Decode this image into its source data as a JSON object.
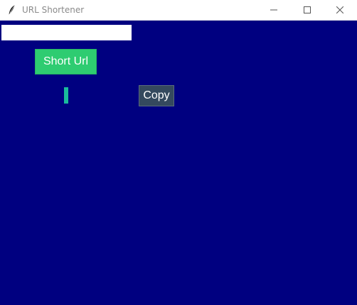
{
  "window": {
    "title": "URL Shortener",
    "icon": "feather-icon",
    "controls": {
      "minimize_icon": "minimize-icon",
      "maximize_icon": "maximize-icon",
      "close_icon": "close-icon"
    }
  },
  "main": {
    "url_input_value": "",
    "short_button_label": "Short Url",
    "result_text": "",
    "copy_button_label": "Copy"
  },
  "colors": {
    "background": "#000080",
    "short_button": "#2ecc71",
    "result_label": "#1abc9c",
    "copy_button": "#34495e"
  }
}
